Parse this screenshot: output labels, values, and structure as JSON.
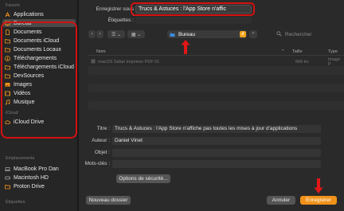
{
  "sidebar": {
    "sections": [
      {
        "title": "Favoris"
      },
      {
        "title": "iCloud"
      },
      {
        "title": "Emplacements"
      },
      {
        "title": "Étiquettes"
      }
    ],
    "favorites": [
      {
        "label": "Applications",
        "icon": "applications-icon"
      },
      {
        "label": "Bureau",
        "icon": "desktop-icon",
        "selected": true
      },
      {
        "label": "Documents",
        "icon": "document-icon"
      },
      {
        "label": "Documents iCloud",
        "icon": "folder-icon"
      },
      {
        "label": "Documents Locaux",
        "icon": "folder-icon"
      },
      {
        "label": "Téléchargements",
        "icon": "download-icon"
      },
      {
        "label": "Téléchargements iCloud",
        "icon": "folder-icon"
      },
      {
        "label": "DevSources",
        "icon": "folder-icon"
      },
      {
        "label": "Images",
        "icon": "images-icon"
      },
      {
        "label": "Vidéos",
        "icon": "videos-icon"
      },
      {
        "label": "Musique",
        "icon": "music-icon"
      }
    ],
    "icloud": [
      {
        "label": "iCloud Drive",
        "icon": "cloud-icon"
      }
    ],
    "locations": [
      {
        "label": "MacBook Pro Dan",
        "icon": "laptop-icon"
      },
      {
        "label": "Macintosh HD",
        "icon": "disk-icon"
      },
      {
        "label": "Proton Drive",
        "icon": "folder-icon"
      }
    ]
  },
  "header": {
    "save_as_label": "Enregistrer sous :",
    "save_as_value": "Trucs & Astuces : l'App Store n'affic",
    "tags_label": "Étiquettes :"
  },
  "toolbar": {
    "location": "Bureau",
    "search_placeholder": "Rechercher"
  },
  "file_list": {
    "columns": {
      "name": "Nom",
      "size": "Taille",
      "type": "Type"
    },
    "rows": [
      {
        "name": "macOS Safari imprimer PDF 01",
        "size": "849 ko",
        "type": "Image P"
      }
    ]
  },
  "metadata": {
    "title_label": "Titre :",
    "title_value": "Trucs & Astuces : l'App Store n'affiche pas toutes les mises à jour d'applications",
    "author_label": "Auteur :",
    "author_value": "Daniel Vinet",
    "subject_label": "Objet :",
    "subject_value": "",
    "keywords_label": "Mots-clés :",
    "keywords_value": "",
    "security_button": "Options de sécurité..."
  },
  "footer": {
    "new_folder": "Nouveau dossier",
    "cancel": "Annuler",
    "save": "Enregistrer"
  },
  "colors": {
    "accent": "#f0921a",
    "highlight_ring": "#d41111",
    "folder": "#f0921a"
  }
}
